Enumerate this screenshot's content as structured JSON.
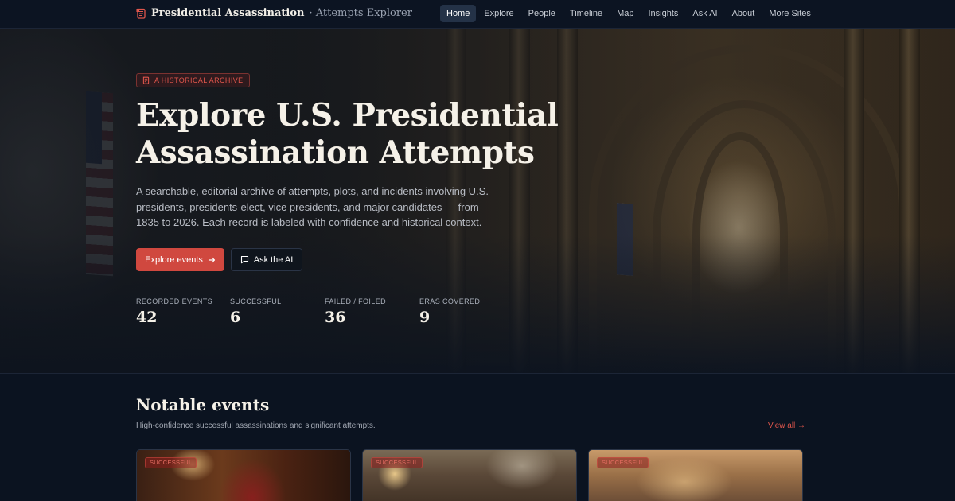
{
  "nav": {
    "brand_main": "Presidential Assassination",
    "brand_sub": "· Attempts Explorer",
    "links": [
      {
        "label": "Home",
        "active": true
      },
      {
        "label": "Explore",
        "active": false
      },
      {
        "label": "People",
        "active": false
      },
      {
        "label": "Timeline",
        "active": false
      },
      {
        "label": "Map",
        "active": false
      },
      {
        "label": "Insights",
        "active": false
      },
      {
        "label": "Ask AI",
        "active": false
      },
      {
        "label": "About",
        "active": false
      },
      {
        "label": "More Sites",
        "active": false
      }
    ]
  },
  "hero": {
    "badge": "A HISTORICAL ARCHIVE",
    "title": "Explore U.S. Presidential Assassination Attempts",
    "description": "A searchable, editorial archive of attempts, plots, and incidents involving U.S. presidents, presidents-elect, vice presidents, and major candidates — from 1835 to 2026. Each record is labeled with confidence and historical context.",
    "primary_button": "Explore events",
    "secondary_button": "Ask the AI",
    "stats": [
      {
        "label": "RECORDED EVENTS",
        "value": "42"
      },
      {
        "label": "SUCCESSFUL",
        "value": "6"
      },
      {
        "label": "FAILED / FOILED",
        "value": "36"
      },
      {
        "label": "ERAS COVERED",
        "value": "9"
      }
    ]
  },
  "notable": {
    "title": "Notable events",
    "subtitle": "High-confidence successful assassinations and significant attempts.",
    "view_all": "View all →",
    "cards": [
      {
        "badge": "SUCCESSFUL"
      },
      {
        "badge": "SUCCESSFUL"
      },
      {
        "badge": "SUCCESSFUL"
      }
    ]
  },
  "colors": {
    "accent": "#d0483f",
    "background": "#0b1320",
    "nav_active": "#243247"
  },
  "icons": {
    "brand": "scroll-icon",
    "badge": "scroll-icon",
    "explore": "arrow-right-icon",
    "ask": "chat-bubble-icon"
  }
}
